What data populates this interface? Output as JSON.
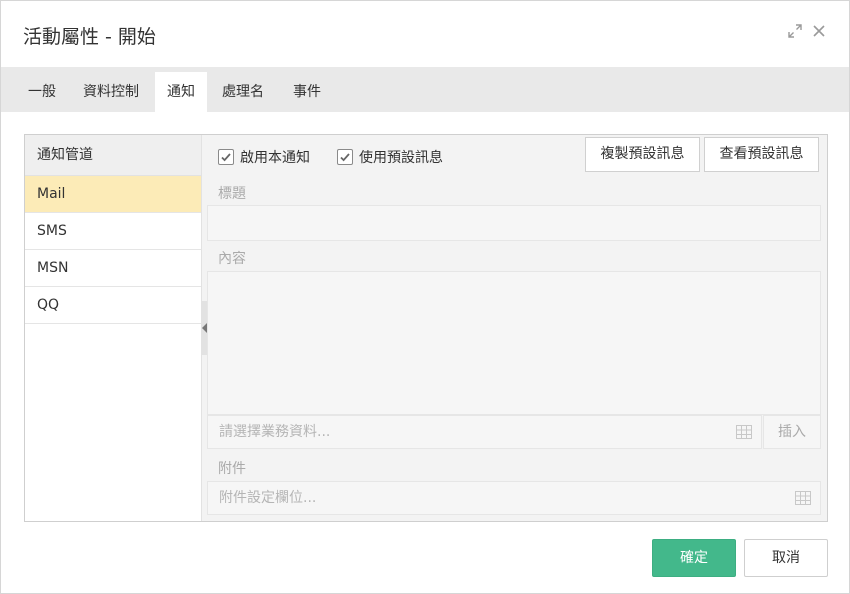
{
  "dialog": {
    "title": "活動屬性 - 開始",
    "icons": [
      "expand-icon",
      "close-icon"
    ]
  },
  "tabs": [
    {
      "label": "一般"
    },
    {
      "label": "資料控制"
    },
    {
      "label": "通知",
      "active": true
    },
    {
      "label": "處理名"
    },
    {
      "label": "事件"
    }
  ],
  "channels": {
    "header": "通知管道",
    "items": [
      {
        "label": "Mail",
        "selected": true
      },
      {
        "label": "SMS"
      },
      {
        "label": "MSN"
      },
      {
        "label": "QQ"
      }
    ]
  },
  "notify": {
    "enable_label": "啟用本通知",
    "enable_checked": true,
    "use_default_label": "使用預設訊息",
    "use_default_checked": true,
    "copy_default_button": "複製預設訊息",
    "view_default_button": "查看預設訊息",
    "subject_label": "標題",
    "subject_value": "",
    "content_label": "內容",
    "content_value": "",
    "business_data_placeholder": "請選擇業務資料...",
    "insert_button": "插入",
    "attachment_label": "附件",
    "attachment_placeholder": "附件設定欄位..."
  },
  "footer": {
    "ok_label": "確定",
    "cancel_label": "取消"
  },
  "colors": {
    "ok_button": "#43b88b",
    "selected_row": "#fcebb7",
    "tab_bar": "#e9e9e9"
  }
}
